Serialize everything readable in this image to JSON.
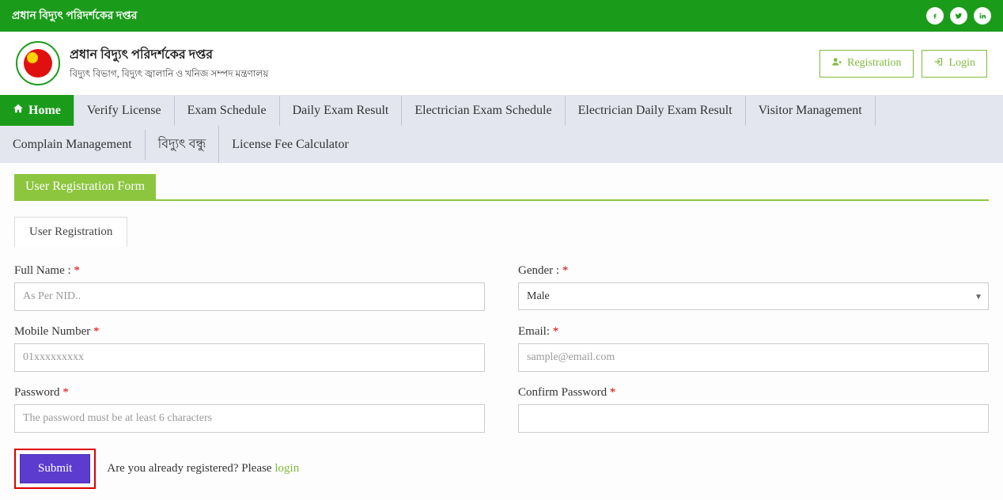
{
  "top_bar": {
    "title": "প্রধান বিদ্যুৎ পরিদর্শকের দপ্তর"
  },
  "header": {
    "title": "প্রধান বিদ্যুৎ পরিদর্শকের দপ্তর",
    "subtitle": "বিদ্যুৎ বিভাগ, বিদ্যুৎ জ্বালানি ও খনিজ সম্পদ মন্ত্রণালয়",
    "register_label": "Registration",
    "login_label": "Login"
  },
  "nav": {
    "items": [
      "Home",
      "Verify License",
      "Exam Schedule",
      "Daily Exam Result",
      "Electrician Exam Schedule",
      "Electrician Daily Exam Result",
      "Visitor Management",
      "Complain Management",
      "বিদ্যুৎ বন্ধু",
      "License Fee Calculator"
    ]
  },
  "section": {
    "title": "User Registration Form",
    "tab_label": "User Registration"
  },
  "form": {
    "full_name": {
      "label": "Full Name :",
      "placeholder": "As Per NID.."
    },
    "gender": {
      "label": "Gender :",
      "value": "Male"
    },
    "mobile": {
      "label": "Mobile Number",
      "placeholder": "01xxxxxxxxx"
    },
    "email": {
      "label": "Email:",
      "placeholder": "sample@email.com"
    },
    "password": {
      "label": "Password",
      "placeholder": "The password must be at least 6 characters"
    },
    "confirm_password": {
      "label": "Confirm Password"
    },
    "submit_label": "Submit",
    "login_hint_prefix": "Are you already registered? Please ",
    "login_link": "login"
  }
}
